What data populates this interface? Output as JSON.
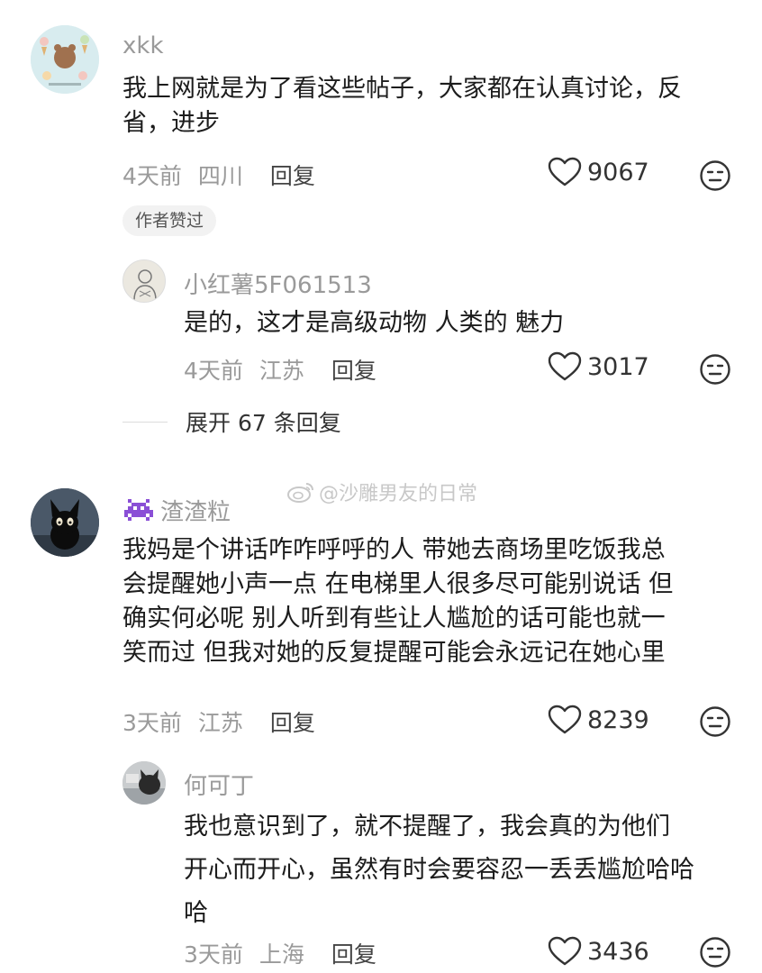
{
  "comments": [
    {
      "username": "xkk",
      "text_lines": [
        "我上网就是为了看这些帖子，大家都在认真讨论，反",
        "省，进步"
      ],
      "time": "4天前",
      "location": "四川",
      "reply_label": "回复",
      "likes": "9067",
      "badge": "作者赞过",
      "avatar_icon": "ice-cream-bear-avatar"
    },
    {
      "username": "小红薯5F061513",
      "text_lines": [
        "是的，这才是高级动物 人类的 魅力"
      ],
      "time": "4天前",
      "location": "江苏",
      "reply_label": "回复",
      "likes": "3017",
      "avatar_icon": "sketch-portrait-avatar"
    },
    {
      "username": "渣渣粒",
      "username_icon": "pixel-invader-icon",
      "text_lines": [
        "我妈是个讲话咋咋呼呼的人 带她去商场里吃饭我总",
        "会提醒她小声一点 在电梯里人很多尽可能别说话 但",
        "确实何必呢 别人听到有些让人尴尬的话可能也就一",
        "笑而过 但我对她的反复提醒可能会永远记在她心里"
      ],
      "time": "3天前",
      "location": "江苏",
      "reply_label": "回复",
      "likes": "8239",
      "avatar_icon": "black-cat-avatar"
    },
    {
      "username": "何可丁",
      "text_lines": [
        "我也意识到了，就不提醒了，我会真的为他们",
        "开心而开心，虽然有时会要容忍一丢丢尴尬哈哈",
        "哈"
      ],
      "time": "3天前",
      "location": "上海",
      "reply_label": "回复",
      "likes": "3436",
      "avatar_icon": "cat-photo-avatar"
    }
  ],
  "expand_replies": "展开 67 条回复",
  "watermark": "@沙雕男友的日常",
  "colors": {
    "meta": "#9a9a9a",
    "text": "#1c1c1c",
    "accent_purple": "#8a4fd6"
  }
}
